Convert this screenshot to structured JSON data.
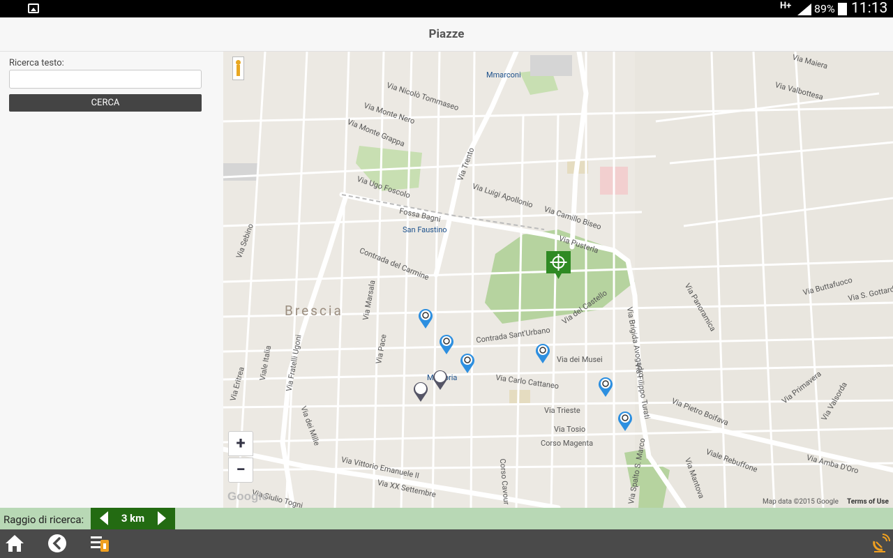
{
  "status": {
    "network": "H+",
    "battery": "89%",
    "time": "11:13"
  },
  "header": {
    "title": "Piazze"
  },
  "search": {
    "label": "Ricerca testo:",
    "value": "",
    "button_label": "CERCA"
  },
  "map": {
    "city": "Brescia",
    "zoom_in": "+",
    "zoom_out": "−",
    "attribution": "Google",
    "map_data": "Map data ©2015 Google",
    "terms": "Terms of Use",
    "labels": {
      "marconi": "Mmarconi",
      "san_faustino": "San Faustino",
      "vittoria": "Mvittoria",
      "via_pusterla": "Via Pusterla",
      "via_trento": "Via Trento",
      "via_musei": "Via dei Musei",
      "via_carlo_cattaneo": "Via Carlo Cattaneo",
      "contrada_sant_urbano": "Contrada Sant'Urbano",
      "via_trieste": "Via Trieste",
      "via_tosio": "Via Tosio",
      "corso_magenta": "Corso Magenta",
      "via_vittorio_emanuele": "Via Vittorio Emanuele II",
      "via_xx_settembre": "Via XX Settembre",
      "via_filippo_turati": "Via Filippo Turati",
      "via_brigida_avogadro": "Via Brigida Avogadro",
      "viale_rebuffone": "Viale Rebuffone",
      "via_buttafuoco": "Via Buttafuoco",
      "via_luigi_apollonio": "Via Luigi Apollonio",
      "via_camillo_biseo": "Via Camillo Biseo",
      "via_ugo_foscolo": "Via Ugo Foscolo",
      "contrada_del_carmine": "Contrada del Carmine",
      "via_monte_grappa": "Via Monte Grappa",
      "via_monte_nero": "Via Monte Nero",
      "via_niccolo_tommaseo": "Via Nicolò Tommaseo",
      "fossa_bagni": "Fossa Bagni",
      "via_del_castello": "Via del Castello",
      "via_panoramica": "Via Panoramica",
      "via_pietro_boifava": "Via Pietro Boifava",
      "via_amba_doro": "Via Amba D'Oro",
      "via_maiera": "Via Maiera",
      "via_valbottesa": "Via Valbottesa",
      "viale_italia": "Viale Italia",
      "via_fratelli_ugoni": "Via Fratelli Ugoni",
      "via_dei_mille": "Via dei Mille",
      "via_marsala": "Via Marsala",
      "via_pace": "Via Pace",
      "corso_cavour": "Corso Cavour",
      "via_spalto_s_marco": "Via Spalto S. Marco",
      "via_mantova": "Via Mantova",
      "via_sebino": "Via Sebino",
      "via_eritrea": "Via Eritrea",
      "via_siulio_togni": "Via Siulio Togni",
      "via_s_gottardo": "Via S. Gottardo",
      "via_primavera": "Via Primavera",
      "via_valsorda": "Via Valsorda"
    }
  },
  "radius": {
    "label": "Raggio di ricerca:",
    "value": "3 km"
  },
  "colors": {
    "accent": "#236b12",
    "radius_bg": "#b8d8b5",
    "pin_blue": "#2d8fe0",
    "pin_gray": "#555566"
  }
}
